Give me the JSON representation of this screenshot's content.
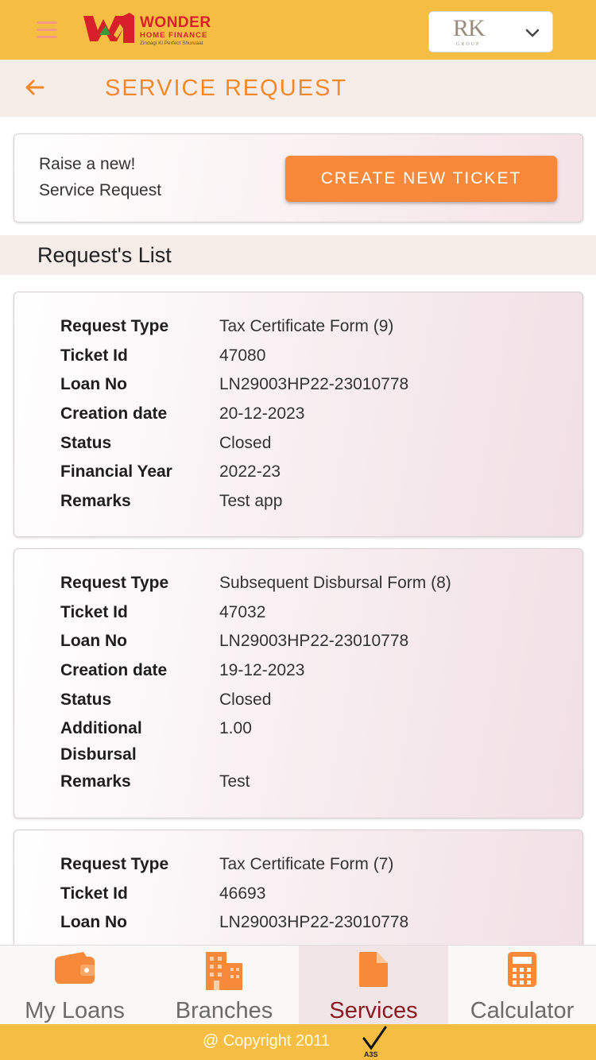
{
  "header": {
    "logo_main": "WONDER",
    "logo_sub": "HOME FINANCE",
    "logo_tagline": "Zindagi Ki Perfect Shuruaat",
    "group_logo": "RK",
    "group_logo_sub": "GROUP"
  },
  "titlebar": {
    "title": "SERVICE REQUEST"
  },
  "raise": {
    "line1": "Raise a new!",
    "line2": "Service Request",
    "button": "CREATE NEW TICKET"
  },
  "list": {
    "title": "Request's List",
    "items": [
      {
        "rows": [
          {
            "k": "Request Type",
            "v": "Tax Certificate Form (9)"
          },
          {
            "k": "Ticket Id",
            "v": "47080"
          },
          {
            "k": "Loan No",
            "v": "LN29003HP22-23010778"
          },
          {
            "k": "Creation date",
            "v": "20-12-2023"
          },
          {
            "k": "Status",
            "v": "Closed"
          },
          {
            "k": "Financial Year",
            "v": "2022-23"
          },
          {
            "k": "Remarks",
            "v": "Test app"
          }
        ]
      },
      {
        "rows": [
          {
            "k": "Request Type",
            "v": "Subsequent Disbursal Form (8)"
          },
          {
            "k": "Ticket Id",
            "v": "47032"
          },
          {
            "k": "Loan No",
            "v": "LN29003HP22-23010778"
          },
          {
            "k": "Creation date",
            "v": "19-12-2023"
          },
          {
            "k": "Status",
            "v": "Closed"
          },
          {
            "k": "Additional Disbursal",
            "v": "1.00"
          },
          {
            "k": "Remarks",
            "v": "Test"
          }
        ]
      },
      {
        "rows": [
          {
            "k": "Request Type",
            "v": "Tax Certificate Form (7)"
          },
          {
            "k": "Ticket Id",
            "v": "46693"
          },
          {
            "k": "Loan No",
            "v": "LN29003HP22-23010778"
          }
        ]
      }
    ]
  },
  "nav": {
    "items": [
      {
        "label": "My Loans",
        "icon": "wallet-icon"
      },
      {
        "label": "Branches",
        "icon": "building-icon"
      },
      {
        "label": "Services",
        "icon": "document-icon"
      },
      {
        "label": "Calculator",
        "icon": "calculator-icon"
      }
    ],
    "active": "Services"
  },
  "footer": {
    "copyright": "@ Copyright 2011",
    "badge": "A3S"
  },
  "colors": {
    "brand_yellow": "#f5be42",
    "accent_orange": "#f28a2c",
    "button_orange": "#f8893a",
    "active_nav": "#8a1c22"
  }
}
